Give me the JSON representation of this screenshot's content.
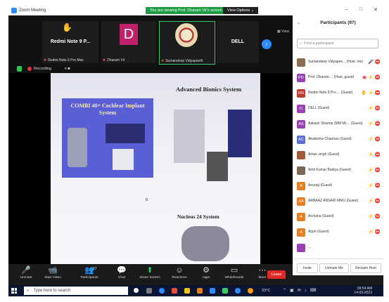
{
  "window": {
    "title": "Zoom Meeting",
    "minimize": "–",
    "maximize": "□",
    "close": "✕"
  },
  "banner": {
    "viewing": "You are viewing Prof. Dharam Vir's screen",
    "view_options": "View Options ⌄"
  },
  "strip": {
    "tiles": [
      {
        "name": "Redmi Note 9 P...",
        "footer": "Redmi Note 9 Pro Max"
      },
      {
        "letter": "D",
        "footer": "Dharam Vir"
      },
      {
        "footer": "Sumandeep Vidyapeeth"
      },
      {
        "name": "DELL",
        "footer": "DELL"
      }
    ],
    "next": "›",
    "view_label": "▦ View"
  },
  "recording": {
    "label": "Recording",
    "controls": "⏸ ■"
  },
  "slide": {
    "combi_title": "COMBI 40+ Cochlear Implant System",
    "advanced_title": "Advanced Bionics System",
    "nucleus_title": "Nucleus 24 System",
    "small_mark": "B"
  },
  "participants": {
    "title": "Participants (97)",
    "search_placeholder": "Find a participant",
    "list": [
      {
        "initials": "",
        "name": "Sumandeep Vidyapee... (Host, me)",
        "color": "#8a6d4d",
        "icons": "🎤 ⛔"
      },
      {
        "initials": "PD",
        "name": "Prof. Dharam ... (Host, guest)",
        "color": "#9a3fb8",
        "icons": "▣ ⚡ ⛔"
      },
      {
        "initials": "RN",
        "name": "Redmi Note 9 Pro ... (Guest)",
        "color": "#c0392b",
        "icons": "✋ ⚡ ⛔"
      },
      {
        "initials": "D",
        "name": "DELL (Guest)",
        "color": "#9a3fb8",
        "icons": "⚡ ⛔"
      },
      {
        "initials": "AS",
        "name": "Aakash Sharma (MM ML... (Guest)",
        "color": "#9a3fb8",
        "icons": "⚡ ⛔"
      },
      {
        "initials": "AC",
        "name": "Akanksha Chauhan (Guest)",
        "color": "#5a6fd6",
        "icons": "⚡ ⛔"
      },
      {
        "initials": "",
        "name": "Aman singh (Guest)",
        "color": "#a55a3a",
        "icons": "⚡ ⛔"
      },
      {
        "initials": "",
        "name": "Amit Kumar Baidya (Guest)",
        "color": "#7a6a55",
        "icons": "⚡ ⛔"
      },
      {
        "initials": "A",
        "name": "Anurag (Guest)",
        "color": "#e67e22",
        "icons": "⚡ ⛔"
      },
      {
        "initials": "AA",
        "name": "ARBAAZ ANSARI MMU (Guest)",
        "color": "#e67e22",
        "icons": "⚡ ⛔"
      },
      {
        "initials": "A",
        "name": "Archana (Guest)",
        "color": "#e67e22",
        "icons": "⚡ ⛔"
      },
      {
        "initials": "A",
        "name": "Arjun (Guest)",
        "color": "#e67e22",
        "icons": "⚡ ⛔"
      },
      {
        "initials": "",
        "name": "...",
        "color": "#9a3fb8",
        "icons": ""
      }
    ],
    "footer": {
      "invite": "Invite",
      "mute_all": "Unmute Me",
      "more": "Reclaim Host"
    }
  },
  "toolbar": {
    "buttons": [
      {
        "icon": "🎤",
        "label": "Unmute"
      },
      {
        "icon": "📹",
        "label": "Start Video"
      },
      {
        "icon": "👥",
        "label": "Participants",
        "count": "97"
      },
      {
        "icon": "💬",
        "label": "Chat"
      },
      {
        "icon": "⬆",
        "label": "Share Screen"
      },
      {
        "icon": "☺",
        "label": "Reactions"
      },
      {
        "icon": "⚙",
        "label": "Apps"
      },
      {
        "icon": "▭",
        "label": "Whiteboards"
      },
      {
        "icon": "⋯",
        "label": "More"
      }
    ],
    "leave": "Leave"
  },
  "taskbar": {
    "search": "Type here to search",
    "temp": "33°C",
    "time": "09:54 AM",
    "date": "14-03-2023"
  }
}
